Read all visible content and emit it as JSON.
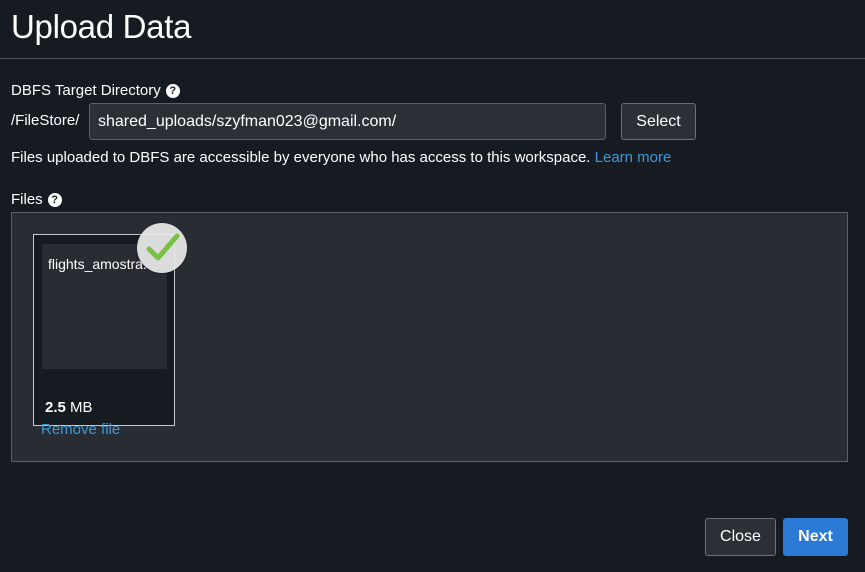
{
  "header": {
    "title": "Upload Data"
  },
  "target": {
    "label": "DBFS Target Directory",
    "help_icon": "question-circle-icon",
    "prefix": "/FileStore/",
    "directory_value": "shared_uploads/szyfman023@gmail.com/",
    "select_label": "Select",
    "helptext": "Files uploaded to DBFS are accessible by everyone who has access to this workspace.",
    "learn_more_label": "Learn more"
  },
  "files": {
    "label": "Files",
    "help_icon": "question-circle-icon",
    "items": [
      {
        "name": "flights_amostra.",
        "size_value": "2.5",
        "size_unit": "MB",
        "remove_label": "Remove file",
        "status_icon": "check-icon"
      }
    ]
  },
  "footer": {
    "close_label": "Close",
    "next_label": "Next"
  },
  "colors": {
    "background": "#161b22",
    "dropzone": "#282d33",
    "link": "#3a9ad9",
    "primary": "#2a7ad5",
    "success": "#7ac142"
  }
}
